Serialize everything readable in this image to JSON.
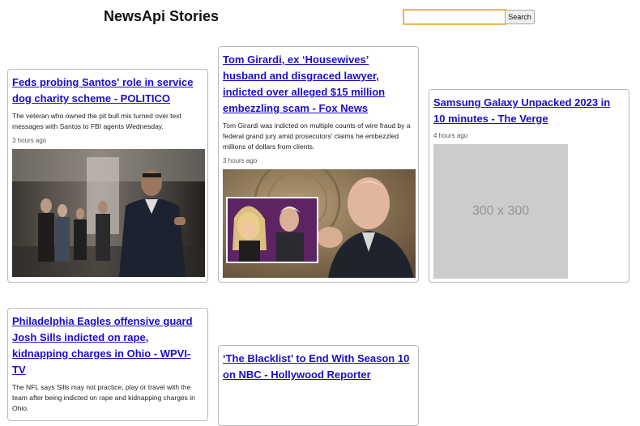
{
  "header": {
    "title": "NewsApi Stories",
    "search_placeholder": "",
    "search_button": "Search"
  },
  "articles": [
    {
      "headline": "Feds probing Santos' role in service dog charity scheme - POLITICO",
      "description": "The veteran who owned the pit bull mix turned over text messages with Santos to FBI agents Wednesday.",
      "time": "3 hours ago"
    },
    {
      "headline": "Tom Girardi, ex ‘Housewives’ husband and disgraced lawyer, indicted over alleged $15 million embezzling scam - Fox News",
      "description": "Tom Girardi was indicted on multiple counts of wire fraud by a federal grand jury amid prosecutors' claims he embezzled millions of dollars from clients.",
      "time": "3 hours ago"
    },
    {
      "headline": "Samsung Galaxy Unpacked 2023 in 10 minutes - The Verge",
      "time": "4 hours ago",
      "placeholder_text": "300 x 300"
    },
    {
      "headline": "Philadelphia Eagles offensive guard Josh Sills indicted on rape, kidnapping charges in Ohio - WPVI-TV",
      "description": "The NFL says Sills may not practice, play or travel with the team after being indicted on rape and kidnapping charges in Ohio."
    },
    {
      "headline": "‘The Blacklist’ to End With Season 10 on NBC - Hollywood Reporter"
    }
  ]
}
